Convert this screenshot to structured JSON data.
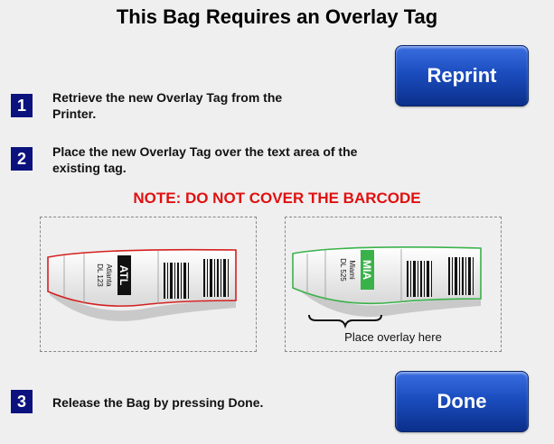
{
  "title": "This Bag Requires an Overlay Tag",
  "buttons": {
    "reprint": "Reprint",
    "done": "Done"
  },
  "steps": [
    {
      "number": "1",
      "text_line1": "Retrieve the new Overlay Tag from the",
      "text_line2": "Printer."
    },
    {
      "number": "2",
      "text_line1": "Place the new Overlay Tag over the text area of the",
      "text_line2": "existing tag."
    },
    {
      "number": "3",
      "text_line1": "Release the Bag by pressing Done.",
      "text_line2": ""
    }
  ],
  "note": "NOTE: DO NOT COVER THE BARCODE",
  "tags": [
    {
      "code": "ATL",
      "city": "Atlanta",
      "flight": "DL 123",
      "accent": "#d42020"
    },
    {
      "code": "MIA",
      "city": "Miami",
      "flight": "DL 525",
      "accent": "#3ab24a"
    }
  ],
  "caption": "Place overlay here"
}
